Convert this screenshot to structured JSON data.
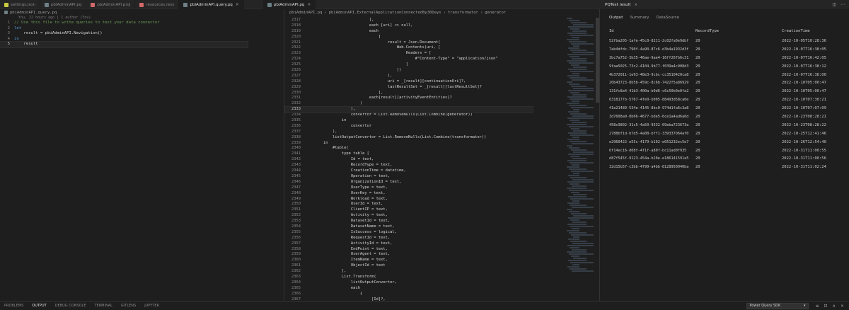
{
  "tabs_left": [
    {
      "label": "settings.json",
      "icon": "json"
    },
    {
      "label": "pbiAdminAPI.pq",
      "icon": "pq"
    },
    {
      "label": "pbiAdminAPI.proj",
      "icon": "red"
    },
    {
      "label": "resources.resx",
      "icon": "red"
    },
    {
      "label": "pbiAdminAPI.query.pq",
      "icon": "pq"
    }
  ],
  "tabs_mid": [
    {
      "label": "pbiAdminAPI.pq",
      "icon": "pq"
    }
  ],
  "left_editor": {
    "breadcrumb": "pbiAdminAPI.query.pq",
    "blame": "You, 22 hours ago | 1 author (You)",
    "lines": [
      {
        "n": "1",
        "text": "// Use this file to write queries to test your data connector",
        "cls": "cm"
      },
      {
        "n": "2",
        "text": "let",
        "cls": "kw"
      },
      {
        "n": "3",
        "text": "    result = pbiAdminAPI.Navigation()",
        "cls": "plain"
      },
      {
        "n": "4",
        "text": "in",
        "cls": "kw"
      },
      {
        "n": "5",
        "text": "    result",
        "cls": "plain"
      }
    ]
  },
  "mid_editor": {
    "breadcrumb": [
      "pbiAdminAPI.pq",
      "pbiAdminAPI.ExternalApplicationConnectedBy30Days",
      "transformator",
      "generator"
    ],
    "lines": [
      {
        "n": "2317",
        "text": "                            ],"
      },
      {
        "n": "2318",
        "text": "                            each [uri] <> null,"
      },
      {
        "n": "2319",
        "text": "                            each"
      },
      {
        "n": "2320",
        "text": "                                ["
      },
      {
        "n": "2321",
        "text": "                                    result = Json.Document("
      },
      {
        "n": "2322",
        "text": "                                        Web.Contents(uri, ["
      },
      {
        "n": "2323",
        "text": "                                            Headers = ["
      },
      {
        "n": "2324",
        "text": "                                                #\"Content-Type\" = \"application/json\""
      },
      {
        "n": "2325",
        "text": "                                            ]"
      },
      {
        "n": "2326",
        "text": "                                        ])"
      },
      {
        "n": "2327",
        "text": "                                    ),"
      },
      {
        "n": "2328",
        "text": "                                    uri = _[result][continuationUri]?,"
      },
      {
        "n": "2329",
        "text": "                                    lastResultSet = _[result][lastResultSet]?"
      },
      {
        "n": "2330",
        "text": "                                ],"
      },
      {
        "n": "2331",
        "text": "                            each[result][activityEventEntities]?"
      },
      {
        "n": "2332",
        "text": "                        )"
      },
      {
        "n": "2333",
        "text": "                    ],"
      },
      {
        "n": "2334",
        "text": "                    convertor = List.RemoveNulls(List.Combine(generator))"
      },
      {
        "n": "2335",
        "text": "                in"
      },
      {
        "n": "2336",
        "text": "                    convertor"
      },
      {
        "n": "2337",
        "text": "            ),"
      },
      {
        "n": "2338",
        "text": "            listOutputConvertor = List.RemoveNulls(List.Combine(transformator))"
      },
      {
        "n": "2339",
        "text": "        in"
      },
      {
        "n": "2340",
        "text": "            #table("
      },
      {
        "n": "2341",
        "text": "                type table ["
      },
      {
        "n": "2342",
        "text": "                    Id = text,"
      },
      {
        "n": "2343",
        "text": "                    RecordType = text,"
      },
      {
        "n": "2344",
        "text": "                    CreationTime = datetime,"
      },
      {
        "n": "2345",
        "text": "                    Operation = text,"
      },
      {
        "n": "2346",
        "text": "                    OrganizationId = text,"
      },
      {
        "n": "2347",
        "text": "                    UserType = text,"
      },
      {
        "n": "2348",
        "text": "                    UserKey = text,"
      },
      {
        "n": "2349",
        "text": "                    Workload = text,"
      },
      {
        "n": "2350",
        "text": "                    UserId = text,"
      },
      {
        "n": "2351",
        "text": "                    ClientIP = text,"
      },
      {
        "n": "2352",
        "text": "                    Activity = text,"
      },
      {
        "n": "2353",
        "text": "                    DatasetId = text,"
      },
      {
        "n": "2354",
        "text": "                    DatasetName = text,"
      },
      {
        "n": "2355",
        "text": "                    IsSuccess = logical,"
      },
      {
        "n": "2356",
        "text": "                    RequestId = text,"
      },
      {
        "n": "2357",
        "text": "                    ActivityId = text,"
      },
      {
        "n": "2358",
        "text": "                    EndPoint = text,"
      },
      {
        "n": "2359",
        "text": "                    UserAgent = text,"
      },
      {
        "n": "2360",
        "text": "                    ItemName = text,"
      },
      {
        "n": "2361",
        "text": "                    ObjectId = text"
      },
      {
        "n": "2362",
        "text": "                ],"
      },
      {
        "n": "2363",
        "text": "                List.Transform("
      },
      {
        "n": "2364",
        "text": "                    listOutputConvertor,"
      },
      {
        "n": "2365",
        "text": "                    each"
      },
      {
        "n": "2366",
        "text": "                        {"
      },
      {
        "n": "2367",
        "text": "                            _[Id]?,"
      },
      {
        "n": "2368",
        "text": "                            Text.From(_[RecordType]?),"
      },
      {
        "n": "2369",
        "text": "                            DateTime.From(_[CreationTime]?),"
      },
      {
        "n": "2370",
        "text": "                            _[Operation]?,"
      },
      {
        "n": "2371",
        "text": "                            _[OrganizationId]?,"
      }
    ]
  },
  "result_pane": {
    "title": "PQTest result",
    "tabs": [
      "Output",
      "Summary",
      "DataSource"
    ],
    "selected_tab": "Output",
    "columns": [
      "Id",
      "RecordType",
      "CreationTime"
    ],
    "rows": [
      [
        "52fba205-1afe-45c0-8211-2c02fa0e9dbf",
        "20",
        "2022-10-05T10:28:36"
      ],
      [
        "7ab4dfdc-790f-4a90-87c6-d3b4a1932d3f",
        "20",
        "2022-10-07T16:38:05"
      ],
      [
        "3bc7a752-3b35-46ae-9ae4-16ff267b6c31",
        "20",
        "2022-10-07T16:42:05"
      ],
      [
        "9faa5025-73c2-4104-9b77-f039a4c908d3",
        "20",
        "2022-10-07T16:38:12"
      ],
      [
        "4b372011-1e93-48e3-9cbc-cc3510420ca8",
        "20",
        "2022-10-07T16:38:00"
      ],
      [
        "20b43723-8b5b-459c-8c6b-7422f5a86929",
        "20",
        "2022-10-10T05:00:47"
      ],
      [
        "131fc8a4-41b3-400a-b0d6-c6c50b0e0fa2",
        "20",
        "2022-10-10T05:00:47"
      ],
      [
        "6318177b-5767-4fe0-b005-88493d58ca0e",
        "20",
        "2022-10-10T07:30:21"
      ],
      [
        "41e21489-534e-4145-8bc0-974d1fa6c3a8",
        "20",
        "2022-10-10T07:07:09"
      ],
      [
        "3d7608a0-8b66-4677-bde5-6ce1a4ad6a6d",
        "20",
        "2022-10-23T08:28:21"
      ],
      [
        "458c9802-31c5-4a50-9532-09eba723673a",
        "20",
        "2022-10-23T08:28:22"
      ],
      [
        "2788bf1d-b7d5-4a08-bff1-339337064af0",
        "20",
        "2022-10-25T12:41:46"
      ],
      [
        "e2960422-e55c-4179-b102-e051232ec5e7",
        "20",
        "2022-10-26T12:54:40"
      ],
      [
        "6f14ec16-d08f-4f1f-a80f-bc11ad0f935",
        "20",
        "2022-10-31T11:00:55"
      ],
      [
        "d87f545f-9123-454a-b20e-e186141591a5",
        "20",
        "2022-10-31T11:00:56"
      ],
      [
        "32d15b57-c3bb-4799-a4bb-8128950040ba",
        "20",
        "2022-10-31T11:02:24"
      ]
    ]
  },
  "bottom_panel": {
    "tabs": [
      "PROBLEMS",
      "OUTPUT",
      "DEBUG CONSOLE",
      "TERMINAL",
      "GITLENS",
      "JUPYTER"
    ],
    "selected_tab": "OUTPUT",
    "output_channel": "Power Query SDK"
  },
  "colors": {
    "background": "#1e1e1e",
    "comment": "#6a9955",
    "keyword": "#569cd6"
  }
}
